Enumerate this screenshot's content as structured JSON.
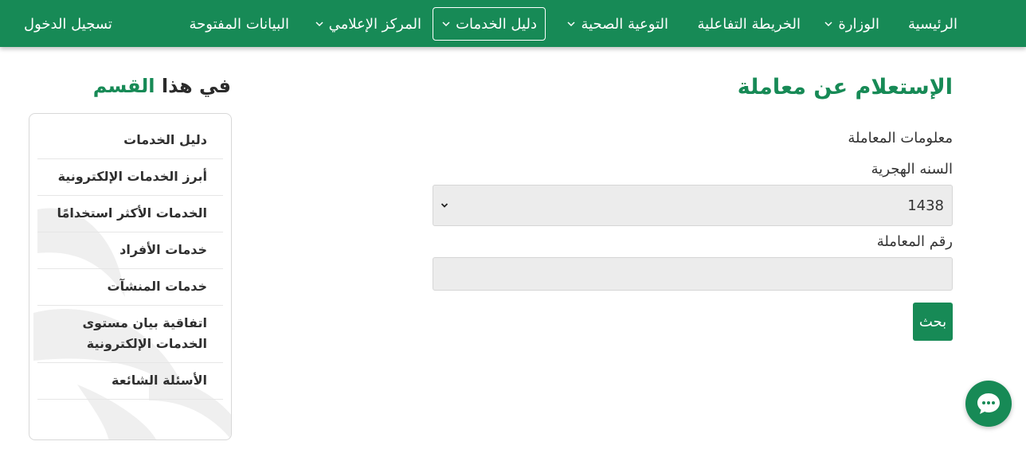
{
  "nav": {
    "items": [
      {
        "label": "الرئيسية",
        "has_dropdown": false,
        "active": false
      },
      {
        "label": "الوزارة",
        "has_dropdown": true,
        "active": false
      },
      {
        "label": "الخريطة التفاعلية",
        "has_dropdown": false,
        "active": false
      },
      {
        "label": "التوعية الصحية",
        "has_dropdown": true,
        "active": false
      },
      {
        "label": "دليل الخدمات",
        "has_dropdown": true,
        "active": true
      },
      {
        "label": "المركز الإعلامي",
        "has_dropdown": true,
        "active": false
      },
      {
        "label": "البيانات المفتوحة",
        "has_dropdown": false,
        "active": false
      }
    ],
    "login_label": "تسجيل الدخول"
  },
  "form": {
    "title": "الإستعلام عن معاملة",
    "section_label": "معلومات المعاملة",
    "year_label": "السنه الهجرية",
    "year_value": "1438",
    "number_label": "رقم المعاملة",
    "number_value": "",
    "search_label": "بحث"
  },
  "sidebar": {
    "heading_part1": "في هذا",
    "heading_part2": "القسم",
    "items": [
      {
        "label": "دليل الخدمات"
      },
      {
        "label": "أبرز الخدمات الإلكترونية"
      },
      {
        "label": "الخدمات الأكثر استخدامًا"
      },
      {
        "label": "خدمات الأفراد"
      },
      {
        "label": "خدمات المنشآت"
      },
      {
        "label": "اتفاقية بيان مستوى الخدمات الإلكترونية"
      },
      {
        "label": "الأسئلة الشائعة"
      }
    ]
  },
  "colors": {
    "brand_green": "#178a56",
    "input_bg": "#ececec"
  },
  "icons": {
    "dropdown": "chevron-down-icon",
    "chat": "chat-bubble-icon"
  }
}
